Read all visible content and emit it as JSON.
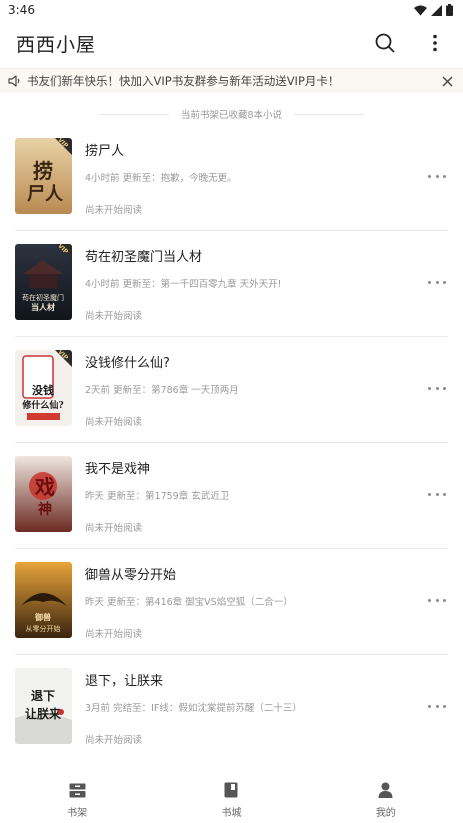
{
  "status_bar": {
    "time": "3:46"
  },
  "app_bar": {
    "title": "西西小屋"
  },
  "notice": {
    "text": "书友们新年快乐！快加入VIP书友群参与新年活动送VIP月卡！"
  },
  "shelf": {
    "summary": "当前书架已收藏8本小说"
  },
  "books": [
    {
      "title": "捞尸人",
      "update": "4小时前 更新至：抱歉，今晚无更。",
      "progress": "尚未开始阅读",
      "cover_text": "捞尸人"
    },
    {
      "title": "苟在初圣魔门当人材",
      "update": "4小时前 更新至：第一千四百零九章 天外天开!",
      "progress": "尚未开始阅读",
      "cover_text": "苟在初圣魔门当人材"
    },
    {
      "title": "没钱修什么仙?",
      "update": "2天前 更新至：第786章 一天顶两月",
      "progress": "尚未开始阅读",
      "cover_text": "没钱修什么仙?"
    },
    {
      "title": "我不是戏神",
      "update": "昨天 更新至：第1759章 玄武近卫",
      "progress": "尚未开始阅读",
      "cover_text": "戏神"
    },
    {
      "title": "御兽从零分开始",
      "update": "昨天 更新至：第416章 御宝VS焰空狐（二合一）",
      "progress": "尚未开始阅读",
      "cover_text": "御兽从零分开始"
    },
    {
      "title": "退下，让朕来",
      "update": "3月前 完结至：IF线：假如沈棠提前苏醒（二十三）",
      "progress": "尚未开始阅读",
      "cover_text": "退下让朕来"
    }
  ],
  "bottom_nav": [
    {
      "label": "书架",
      "icon": "bookshelf-icon"
    },
    {
      "label": "书城",
      "icon": "book-icon"
    },
    {
      "label": "我的",
      "icon": "person-icon"
    }
  ],
  "colors": {
    "notice_bg": "#fbf8f3",
    "muted_text": "#9a9a9a",
    "divider": "#ebebeb"
  }
}
